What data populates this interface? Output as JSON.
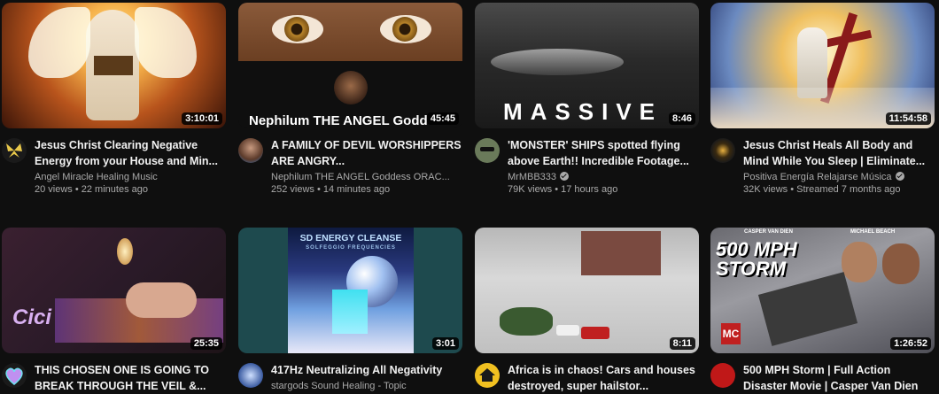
{
  "videos": [
    {
      "title": "Jesus Christ Clearing Negative Energy from your House and Min...",
      "channel": "Angel Miracle Healing Music",
      "views": "20 views",
      "age": "22 minutes ago",
      "duration": "3:10:01",
      "verified": false
    },
    {
      "title": "A FAMILY OF DEVIL WORSHIPPERS ARE ANGRY...",
      "channel": "Nephilum THE ANGEL Goddess ORAC...",
      "views": "252 views",
      "age": "14 minutes ago",
      "duration": "45:45",
      "verified": false,
      "thumb_text": "Nephilum THE ANGEL Godd"
    },
    {
      "title": "'MONSTER' SHIPS spotted flying above Earth!! Incredible Footage...",
      "channel": "MrMBB333",
      "views": "79K views",
      "age": "17 hours ago",
      "duration": "8:46",
      "verified": true,
      "thumb_text": "MASSIVE"
    },
    {
      "title": "Jesus Christ Heals All Body and Mind While You Sleep | Eliminate...",
      "channel": "Positiva Energía Relajarse Música",
      "views": "32K views",
      "age": "Streamed 7 months ago",
      "duration": "11:54:58",
      "verified": true
    },
    {
      "title": "THIS CHOSEN ONE IS GOING TO BREAK THROUGH THE VEIL &...",
      "duration": "25:35",
      "thumb_text": "Cici"
    },
    {
      "title": "417Hz Neutralizing All Negativity",
      "channel": "stargods Sound Healing - Topic",
      "duration": "3:01",
      "thumb_text": "SD ENERGY CLEANSE",
      "thumb_subtext": "SOLFEGGIO FREQUENCIES"
    },
    {
      "title": "Africa is in chaos! Cars and houses destroyed, super hailstor...",
      "duration": "8:11"
    },
    {
      "title": "500 MPH Storm | Full Action Disaster Movie | Casper Van Dien",
      "duration": "1:26:52",
      "thumb_text": "500 MPH STORM",
      "thumb_actor1": "CASPER VAN DIEN",
      "thumb_actor2": "MICHAEL BEACH",
      "avatar_text": "MC"
    }
  ]
}
